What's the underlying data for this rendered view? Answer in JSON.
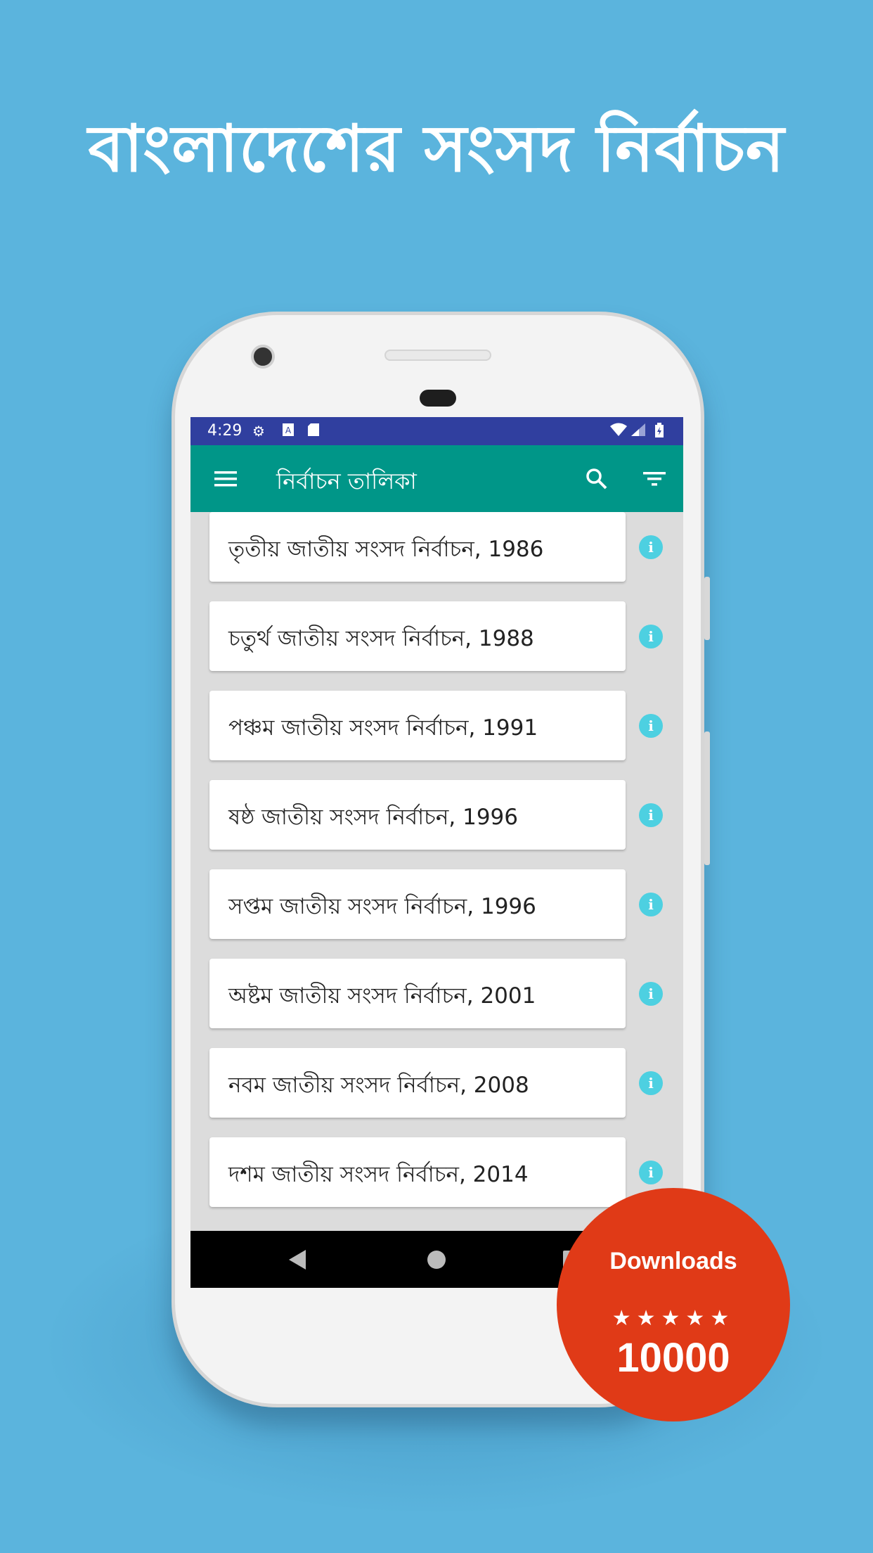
{
  "headline": "বাংলাদেশের সংসদ নির্বাচন",
  "status_bar": {
    "time": "4:29",
    "icons": [
      "gear-icon",
      "a-box-icon",
      "sd-card-icon",
      "wifi-icon",
      "signal-icon",
      "battery-icon"
    ]
  },
  "app_bar": {
    "title": "নির্বাচন তালিকা",
    "icons": [
      "menu-icon",
      "search-icon",
      "filter-icon"
    ],
    "color": "#009688"
  },
  "elections": [
    {
      "label": "তৃতীয় জাতীয় সংসদ নির্বাচন, 1986",
      "icon": "i"
    },
    {
      "label": "চতুর্থ জাতীয় সংসদ নির্বাচন, 1988",
      "icon": "i"
    },
    {
      "label": "পঞ্চম জাতীয় সংসদ নির্বাচন, 1991",
      "icon": "i"
    },
    {
      "label": "ষষ্ঠ জাতীয় সংসদ নির্বাচন, 1996",
      "icon": "i"
    },
    {
      "label": "সপ্তম জাতীয় সংসদ নির্বাচন, 1996",
      "icon": "i"
    },
    {
      "label": "অষ্টম জাতীয় সংসদ নির্বাচন, 2001",
      "icon": "i"
    },
    {
      "label": "নবম জাতীয় সংসদ নির্বাচন, 2008",
      "icon": "i"
    },
    {
      "label": "দশম জাতীয় সংসদ নির্বাচন, 2014",
      "icon": "i"
    }
  ],
  "badge": {
    "title": "Downloads",
    "stars": "★★★★★",
    "count": "10000",
    "color": "#e03a17"
  },
  "colors": {
    "background": "#5bb4dd",
    "status_bar": "#303f9f",
    "info_icon": "#4dd0e1"
  }
}
